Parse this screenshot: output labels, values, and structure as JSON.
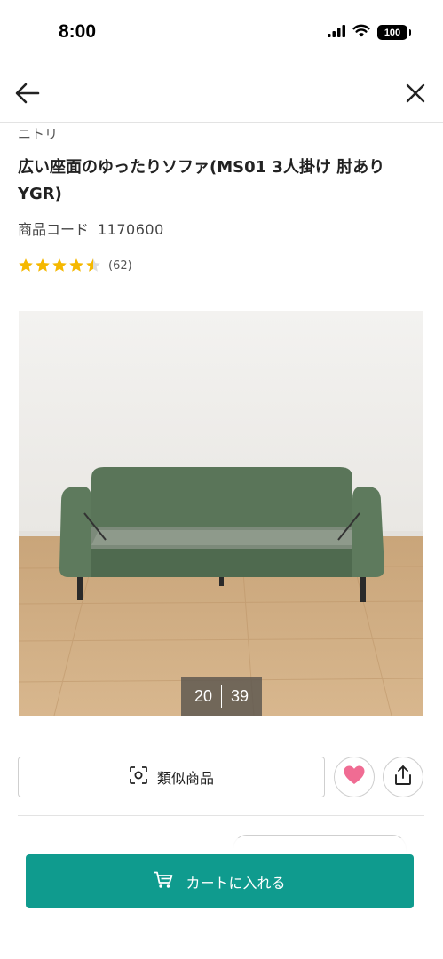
{
  "status_bar": {
    "time": "8:00",
    "battery": "100",
    "icons": [
      "signal-icon",
      "wifi-icon",
      "battery-icon"
    ]
  },
  "nav": {
    "back_icon": "arrow-left-icon",
    "close_icon": "close-icon"
  },
  "product": {
    "brand": "ニトリ",
    "title": "広い座面のゆったりソファ(MS01 3人掛け 肘あり YGR)",
    "code_label": "商品コード",
    "code_value": "1170600",
    "rating_value": 4.5,
    "review_count": "(62)"
  },
  "gallery": {
    "current": "20",
    "total": "39"
  },
  "actions": {
    "similar_label": "類似商品",
    "similar_icon": "camera-scan-icon",
    "favorite_icon": "heart-icon",
    "share_icon": "share-icon"
  },
  "cart": {
    "label": "カートに入れる",
    "icon": "cart-icon"
  },
  "colors": {
    "accent": "#0f9b8e",
    "star": "#f5b800",
    "heart": "#f06c93"
  }
}
